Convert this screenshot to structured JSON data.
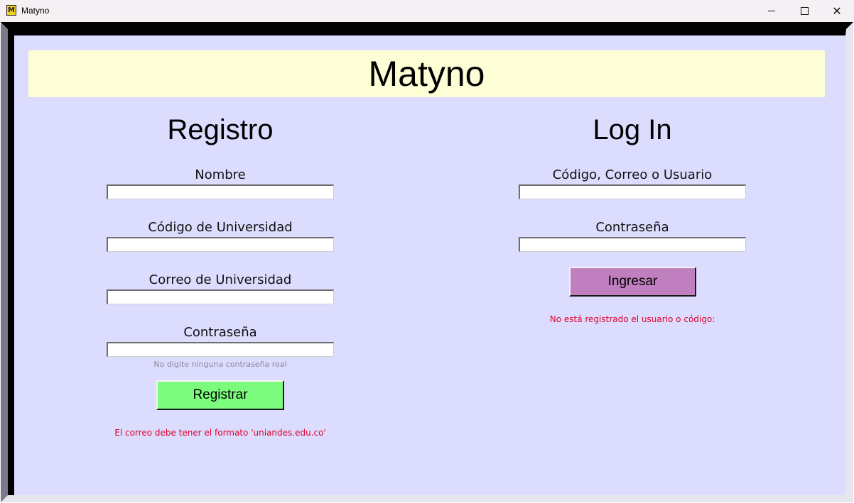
{
  "window": {
    "title": "Matyno",
    "icon_letter": "M"
  },
  "banner": {
    "title": "Matyno"
  },
  "register": {
    "title": "Registro",
    "fields": [
      {
        "label": "Nombre",
        "value": ""
      },
      {
        "label": "Código de Universidad",
        "value": ""
      },
      {
        "label": "Correo de Universidad",
        "value": ""
      },
      {
        "label": "Contraseña",
        "value": ""
      }
    ],
    "password_hint": "No digite ninguna contraseña real",
    "button_label": "Registrar",
    "error": "El correo debe tener el formato 'uniandes.edu.co'"
  },
  "login": {
    "title": "Log In",
    "fields": [
      {
        "label": "Código, Correo o Usuario",
        "value": ""
      },
      {
        "label": "Contraseña",
        "value": ""
      }
    ],
    "button_label": "Ingresar",
    "error": "No está registrado el usuario o código:"
  },
  "colors": {
    "background": "#dcdcff",
    "banner": "#fefed6",
    "register_button": "#7cfc7c",
    "login_button": "#c080c0",
    "error_text": "#e0002a"
  }
}
